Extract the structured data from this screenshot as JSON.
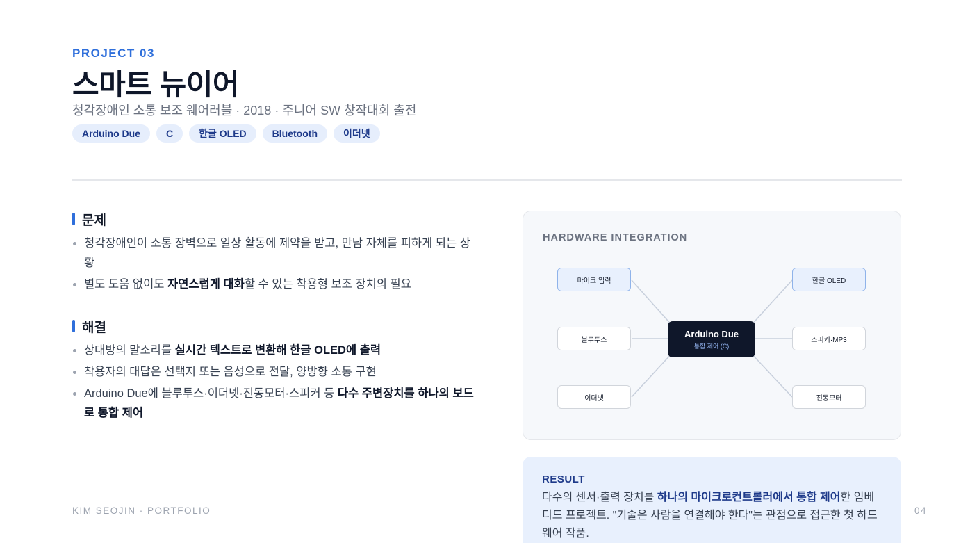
{
  "header": {
    "kicker": "PROJECT 03",
    "title": "스마트 뉴이어",
    "subtitle": "청각장애인 소통 보조 웨어러블 · 2018 · 주니어 SW 창작대회 출전",
    "tags": [
      "Arduino Due",
      "C",
      "한글 OLED",
      "Bluetooth",
      "이더넷"
    ]
  },
  "problem": {
    "title": "문제",
    "items": [
      [
        {
          "t": "청각장애인이 소통 장벽으로 일상 활동에 제약을 받고, 만남 자체를 피하게 되는 상황"
        }
      ],
      [
        {
          "t": "별도 도움 없이도 "
        },
        {
          "t": "자연스럽게 대화",
          "b": true
        },
        {
          "t": "할 수 있는 착용형 보조 장치의 필요"
        }
      ]
    ]
  },
  "solution": {
    "title": "해결",
    "items": [
      [
        {
          "t": "상대방의 말소리를 "
        },
        {
          "t": "실시간 텍스트로 변환해 한글 OLED에 출력",
          "b": true
        }
      ],
      [
        {
          "t": "착용자의 대답은 선택지 또는 음성으로 전달, 양방향 소통 구현"
        }
      ],
      [
        {
          "t": "Arduino Due에 블루투스·이더넷·진동모터·스피커 등 "
        },
        {
          "t": "다수 주변장치를 하나의 보드로 통합 제어",
          "b": true
        }
      ]
    ]
  },
  "hardware": {
    "title": "HARDWARE INTEGRATION",
    "center_title": "Arduino Due",
    "center_sub": "통합 제어 (C)",
    "nodes": {
      "mic": "마이크 입력",
      "bluetooth": "블루투스",
      "ethernet": "이더넷",
      "oled": "한글 OLED",
      "speaker": "스피커·MP3",
      "vibration": "진동모터"
    },
    "colors": {
      "line": "#c7cfdc",
      "center": "#0f172a",
      "accent": "#2f6fdb"
    }
  },
  "result": {
    "title": "RESULT",
    "text": [
      {
        "t": "다수의 센서·출력 장치를 "
      },
      {
        "t": "하나의 마이크로컨트롤러에서 통합 제어",
        "b": true
      },
      {
        "t": "한 임베디드 프로젝트. \"기술은 사람을 연결해야 한다\"는 관점으로 접근한 첫 하드웨어 작품."
      }
    ]
  },
  "footer": {
    "left": "KIM SEOJIN · PORTFOLIO",
    "right": "04"
  }
}
